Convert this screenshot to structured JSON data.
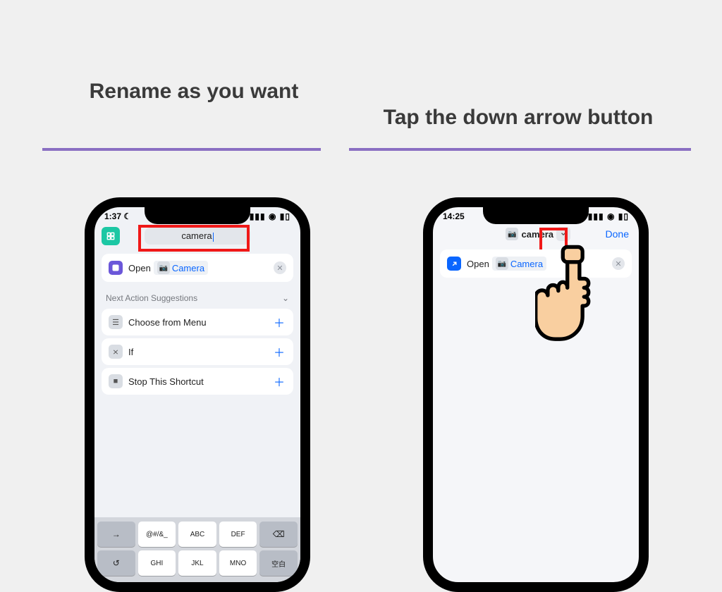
{
  "captions": {
    "left": "Rename as you want",
    "right": "Tap the down arrow button"
  },
  "phone1": {
    "time": "1:37",
    "moon": "☾",
    "title_value": "camera",
    "open_action": {
      "verb": "Open",
      "app": "Camera"
    },
    "suggestions_header": "Next Action Suggestions",
    "suggestions": [
      {
        "icon": "menu",
        "label": "Choose from Menu"
      },
      {
        "icon": "if",
        "label": "If"
      },
      {
        "icon": "stop",
        "label": "Stop This Shortcut"
      }
    ],
    "keyboard": {
      "row1": [
        "→",
        "@#/&_",
        "ABC",
        "DEF",
        "⌫"
      ],
      "row2": [
        "↺",
        "GHI",
        "JKL",
        "MNO",
        "空白"
      ]
    }
  },
  "phone2": {
    "time": "14:25",
    "title_value": "camera",
    "done": "Done",
    "open_action": {
      "verb": "Open",
      "app": "Camera"
    }
  },
  "colors": {
    "underline": "#8a6fc2",
    "highlight": "#f01818",
    "link": "#0a66ff"
  }
}
